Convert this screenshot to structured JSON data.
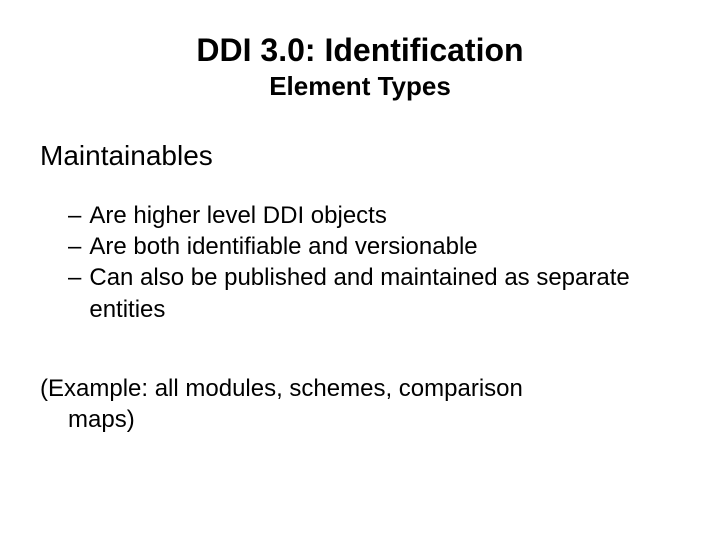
{
  "title": "DDI 3.0: Identification",
  "subtitle": "Element Types",
  "section_heading": "Maintainables",
  "bullets": [
    "Are higher level DDI objects",
    "Are both identifiable and versionable",
    "Can also be published and maintained as separate entities"
  ],
  "example_line1": "(Example: all modules, schemes, comparison",
  "example_line2": "maps)"
}
